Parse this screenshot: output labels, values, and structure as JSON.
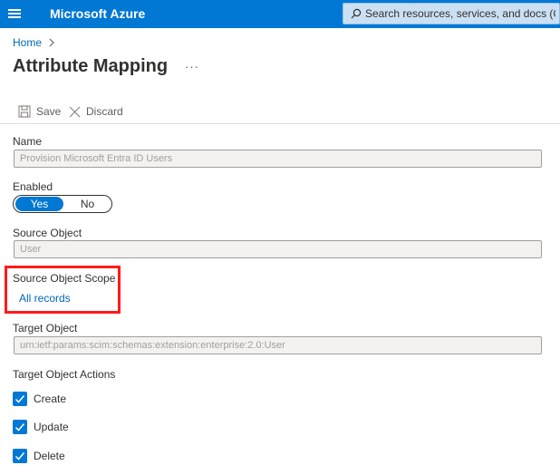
{
  "header": {
    "brand": "Microsoft Azure",
    "search_placeholder": "Search resources, services, and docs (G+/)",
    "accent": "#0078d4"
  },
  "breadcrumb": {
    "home": "Home",
    "separator": ">"
  },
  "page": {
    "title": "Attribute Mapping",
    "more": "···"
  },
  "toolbar": {
    "save_label": "Save",
    "discard_label": "Discard"
  },
  "form": {
    "name": {
      "label": "Name",
      "value": "Provision Microsoft Entra ID Users"
    },
    "enabled": {
      "label": "Enabled",
      "yes": "Yes",
      "no": "No",
      "selected": "Yes"
    },
    "source_object": {
      "label": "Source Object",
      "value": "User"
    },
    "source_object_scope": {
      "label": "Source Object Scope",
      "link": "All records",
      "highlight_color": "#ff1a1a"
    },
    "target_object": {
      "label": "Target Object",
      "value": "urn:ietf:params:scim:schemas:extension:enterprise:2.0:User"
    },
    "target_object_actions": {
      "label": "Target Object Actions",
      "items": [
        {
          "label": "Create",
          "checked": true
        },
        {
          "label": "Update",
          "checked": true
        },
        {
          "label": "Delete",
          "checked": true
        }
      ]
    }
  }
}
